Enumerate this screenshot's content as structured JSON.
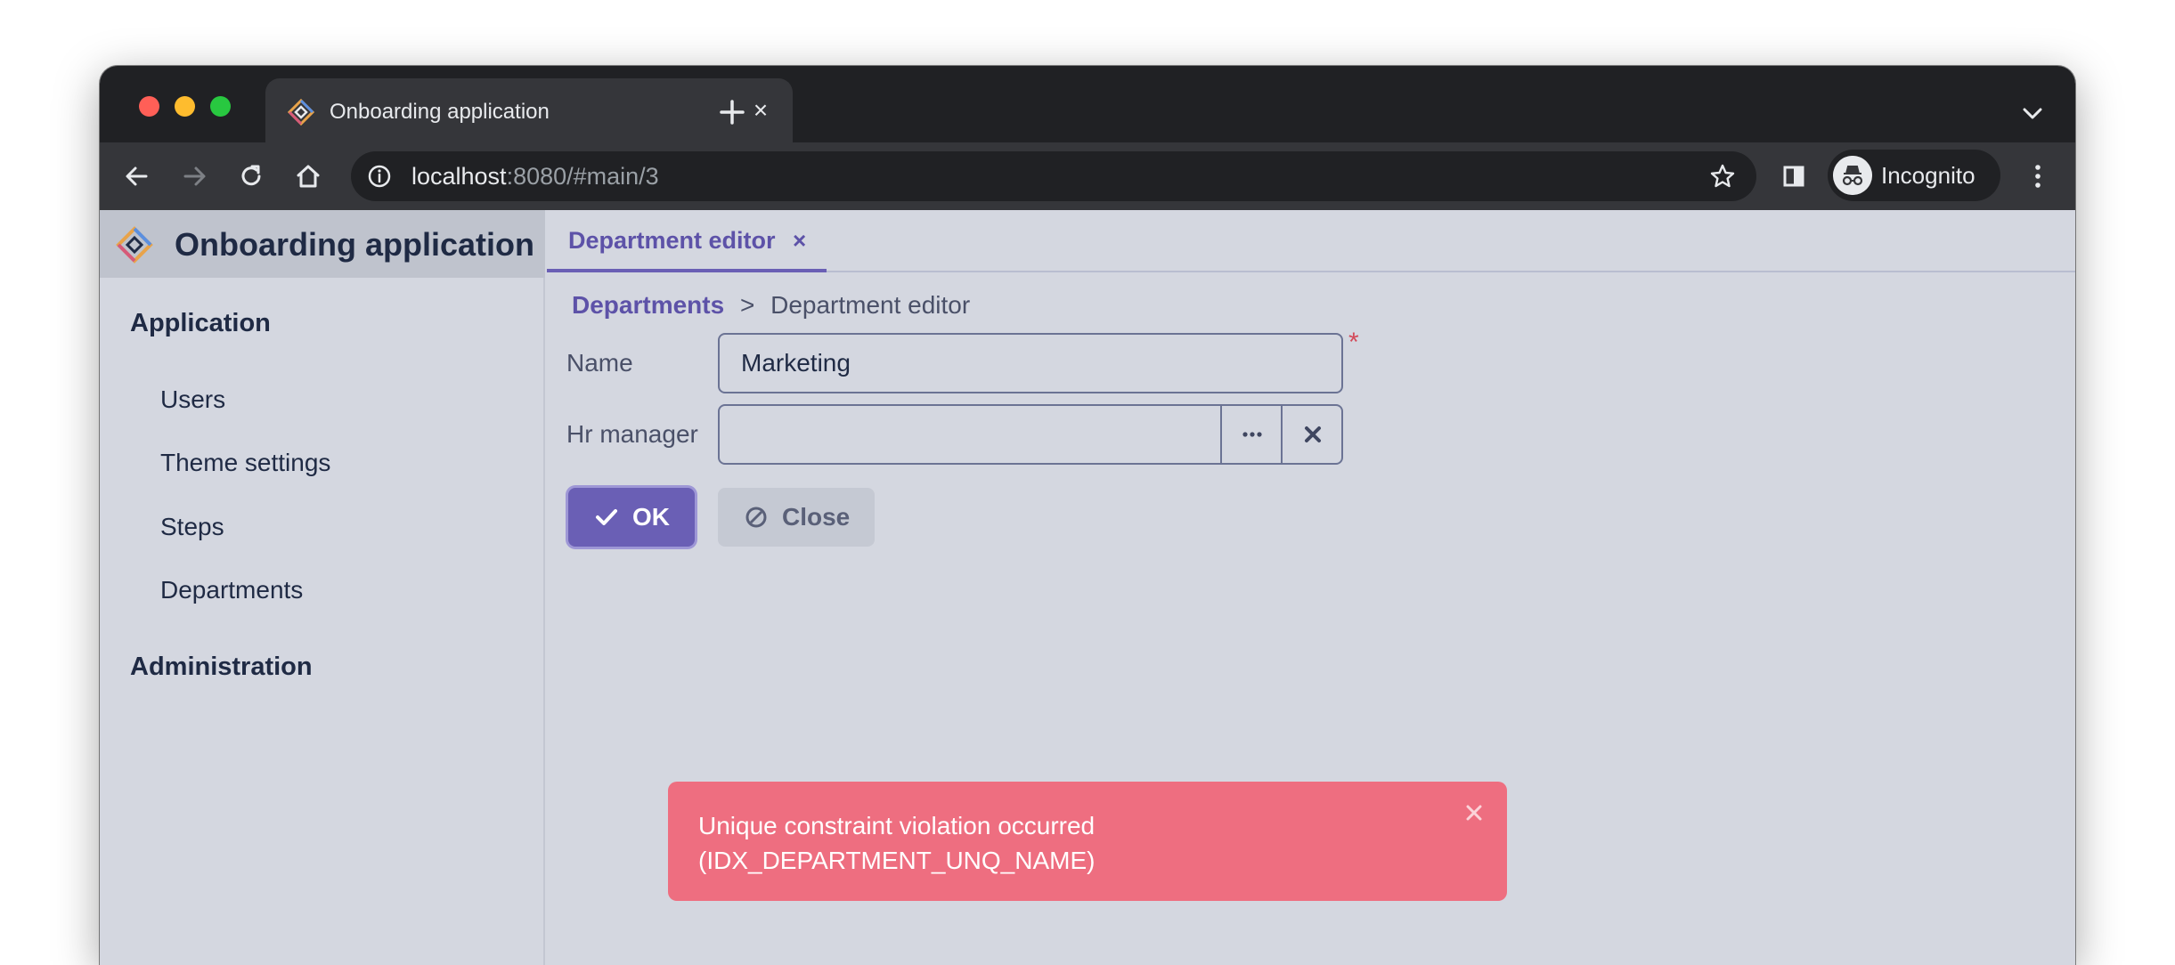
{
  "browser": {
    "tab_title": "Onboarding application",
    "url_host": "localhost",
    "url_rest": ":8080/#main/3",
    "profile_label": "Incognito"
  },
  "app": {
    "title": "Onboarding application"
  },
  "sidebar": {
    "groups": [
      {
        "label": "Application",
        "items": [
          {
            "label": "Users"
          },
          {
            "label": "Theme settings"
          },
          {
            "label": "Steps"
          },
          {
            "label": "Departments"
          }
        ]
      },
      {
        "label": "Administration",
        "items": []
      }
    ]
  },
  "tabs": [
    {
      "label": "Department editor",
      "close": "×"
    }
  ],
  "breadcrumb": {
    "parent": "Departments",
    "separator": ">",
    "current": "Department editor"
  },
  "form": {
    "name_label": "Name",
    "name_value": "Marketing",
    "required_marker": "*",
    "hr_manager_label": "Hr manager",
    "hr_manager_value": ""
  },
  "actions": {
    "ok_label": "OK",
    "close_label": "Close"
  },
  "notification": {
    "line1": "Unique constraint violation occurred",
    "line2": "(IDX_DEPARTMENT_UNQ_NAME)"
  },
  "colors": {
    "accent": "#6a5fb5",
    "error": "#ee6e80",
    "sidebar_header": "#bfc3cd",
    "background": "#d4d7e0"
  },
  "icons": {
    "favicon": "jmix-logo-icon",
    "back": "arrow-left-icon",
    "forward": "arrow-right-icon",
    "reload": "reload-icon",
    "home": "home-icon",
    "info": "info-icon",
    "bookmark": "star-icon",
    "side_panel": "side-panel-icon",
    "profile": "incognito-icon",
    "menu": "kebab-menu-icon",
    "lookup": "ellipsis-icon",
    "clear": "close-icon",
    "ok": "checkmark-icon",
    "close": "ban-icon"
  }
}
